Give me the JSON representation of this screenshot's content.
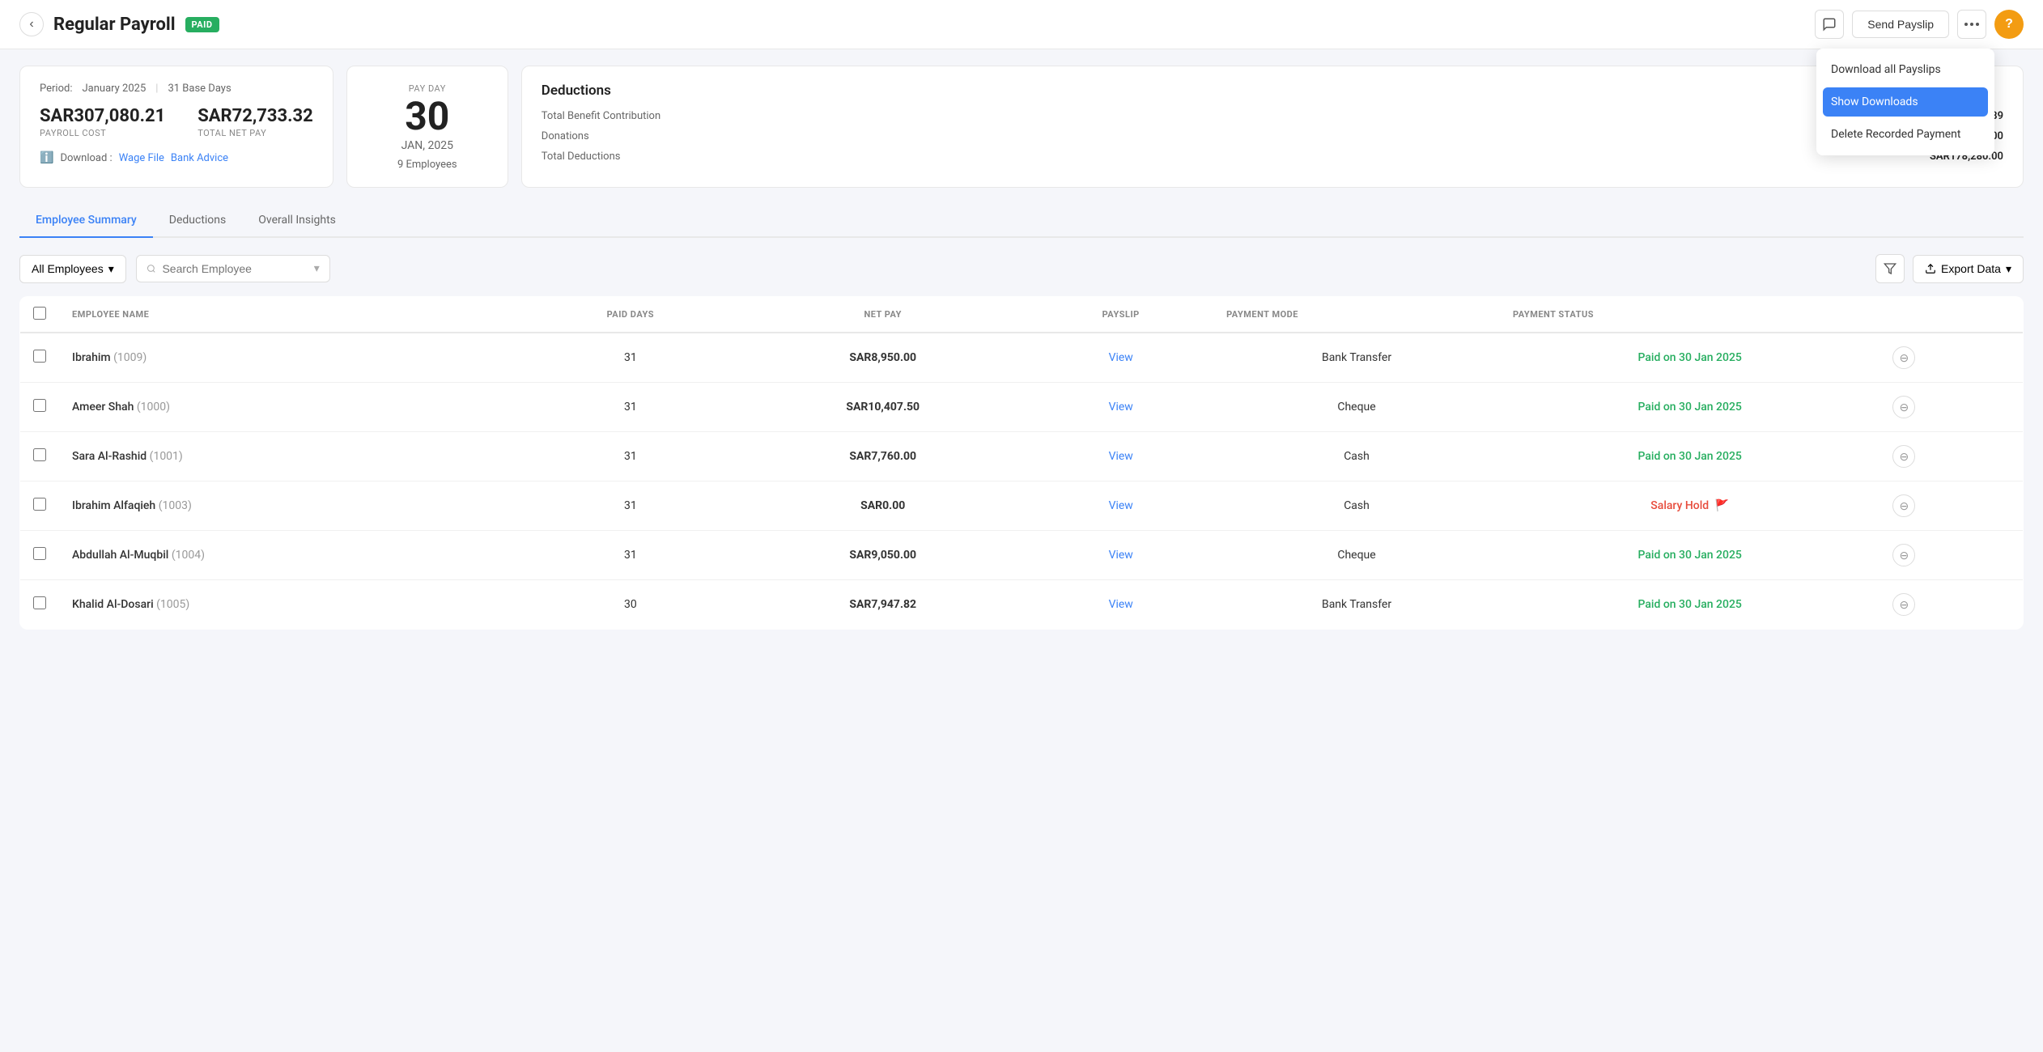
{
  "header": {
    "back_label": "‹",
    "title": "Regular Payroll",
    "badge": "PAID",
    "send_payslip_label": "Send Payslip",
    "more_icon": "•••",
    "help_icon": "?"
  },
  "dropdown": {
    "items": [
      {
        "id": "download-all",
        "label": "Download all Payslips",
        "active": false
      },
      {
        "id": "show-downloads",
        "label": "Show Downloads",
        "active": true
      },
      {
        "id": "delete-payment",
        "label": "Delete Recorded Payment",
        "active": false
      }
    ]
  },
  "payroll_card": {
    "period_label": "Period:",
    "period_value": "January 2025",
    "base_days": "31 Base Days",
    "payroll_cost": "SAR307,080.21",
    "payroll_cost_label": "PAYROLL COST",
    "total_net_pay": "SAR72,733.32",
    "total_net_pay_label": "TOTAL NET PAY",
    "download_label": "Download :",
    "wage_file_label": "Wage File",
    "bank_advice_label": "Bank Advice"
  },
  "payday_card": {
    "label": "PAY DAY",
    "day": "30",
    "month": "JAN, 2025",
    "employees": "9 Employees"
  },
  "deductions_card": {
    "title": "Deductions",
    "rows": [
      {
        "label": "Total Benefit Contribution",
        "value": "SAR56,066.89"
      },
      {
        "label": "Donations",
        "value": "SAR0.00"
      },
      {
        "label": "Total Deductions",
        "value": "SAR178,280.00"
      }
    ]
  },
  "tabs": [
    {
      "id": "employee-summary",
      "label": "Employee Summary",
      "active": true
    },
    {
      "id": "deductions",
      "label": "Deductions",
      "active": false
    },
    {
      "id": "overall-insights",
      "label": "Overall Insights",
      "active": false
    }
  ],
  "table_controls": {
    "all_employees_label": "All Employees",
    "search_placeholder": "Search Employee",
    "filter_icon": "filter",
    "export_label": "Export Data"
  },
  "table": {
    "columns": [
      {
        "id": "employee-name",
        "label": "EMPLOYEE NAME"
      },
      {
        "id": "paid-days",
        "label": "PAID DAYS"
      },
      {
        "id": "net-pay",
        "label": "NET PAY"
      },
      {
        "id": "payslip",
        "label": "PAYSLIP"
      },
      {
        "id": "payment-mode",
        "label": "PAYMENT MODE"
      },
      {
        "id": "payment-status",
        "label": "PAYMENT STATUS"
      }
    ],
    "rows": [
      {
        "id": 1,
        "name": "Ibrahim",
        "emp_id": "(1009)",
        "paid_days": 31,
        "net_pay": "SAR8,950.00",
        "payslip": "View",
        "payment_mode": "Bank Transfer",
        "status": "Paid on 30 Jan 2025",
        "status_type": "paid"
      },
      {
        "id": 2,
        "name": "Ameer Shah",
        "emp_id": "(1000)",
        "paid_days": 31,
        "net_pay": "SAR10,407.50",
        "payslip": "View",
        "payment_mode": "Cheque",
        "status": "Paid on 30 Jan 2025",
        "status_type": "paid"
      },
      {
        "id": 3,
        "name": "Sara Al-Rashid",
        "emp_id": "(1001)",
        "paid_days": 31,
        "net_pay": "SAR7,760.00",
        "payslip": "View",
        "payment_mode": "Cash",
        "status": "Paid on 30 Jan 2025",
        "status_type": "paid"
      },
      {
        "id": 4,
        "name": "Ibrahim Alfaqieh",
        "emp_id": "(1003)",
        "paid_days": 31,
        "net_pay": "SAR0.00",
        "payslip": "View",
        "payment_mode": "Cash",
        "status": "Salary Hold",
        "status_type": "hold"
      },
      {
        "id": 5,
        "name": "Abdullah Al-Muqbil",
        "emp_id": "(1004)",
        "paid_days": 31,
        "net_pay": "SAR9,050.00",
        "payslip": "View",
        "payment_mode": "Cheque",
        "status": "Paid on 30 Jan 2025",
        "status_type": "paid"
      },
      {
        "id": 6,
        "name": "Khalid Al-Dosari",
        "emp_id": "(1005)",
        "paid_days": 30,
        "net_pay": "SAR7,947.82",
        "payslip": "View",
        "payment_mode": "Bank Transfer",
        "status": "Paid on 30 Jan 2025",
        "status_type": "paid"
      }
    ]
  }
}
